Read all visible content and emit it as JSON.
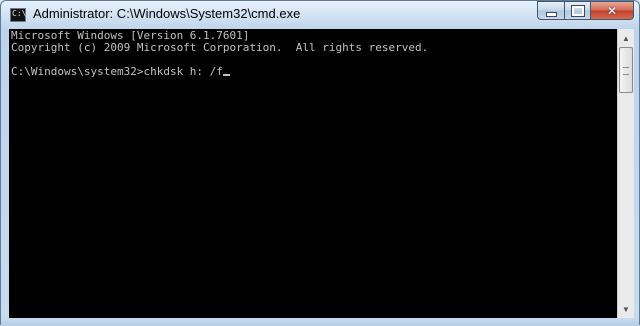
{
  "window": {
    "title": "Administrator: C:\\Windows\\System32\\cmd.exe",
    "icon_text": "C:\\",
    "minimize_icon": "minimize-icon",
    "maximize_icon": "maximize-icon",
    "close_icon": "close-icon"
  },
  "console": {
    "lines": [
      "Microsoft Windows [Version 6.1.7601]",
      "Copyright (c) 2009 Microsoft Corporation.  All rights reserved.",
      "",
      "C:\\Windows\\system32>chkdsk h: /f"
    ],
    "text_color": "#c0c0c0",
    "background": "#000000"
  },
  "scrollbar": {
    "up_arrow": "▲",
    "down_arrow": "▼"
  }
}
